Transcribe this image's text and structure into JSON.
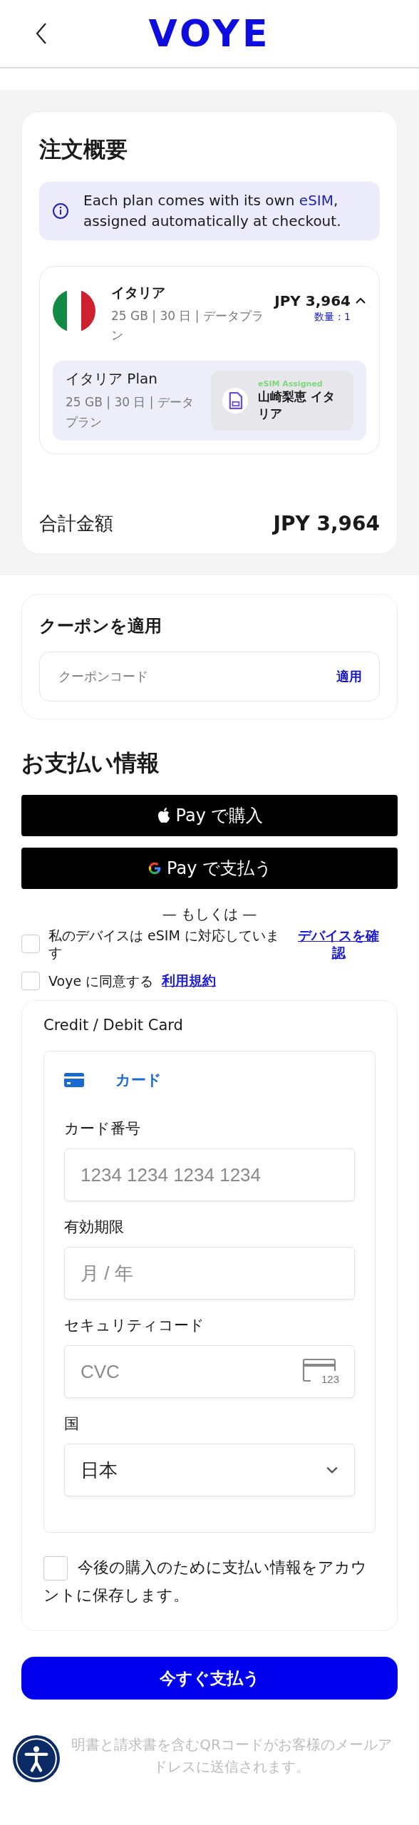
{
  "header": {
    "logo": "VOYE"
  },
  "order_summary": {
    "title": "注文概要",
    "notice": {
      "before": "Each plan comes with its own ",
      "highlight": "eSIM",
      "after": ", assigned automatically at checkout."
    },
    "items": [
      {
        "country": "イタリア",
        "details": "25 GB | 30 日 | データプラン",
        "price": "JPY 3,964",
        "quantity": "数量 : 1",
        "expanded": true,
        "plans": [
          {
            "name": "イタリア Plan",
            "details": "25 GB | 30 日 | データプラン",
            "esim_status": "eSIM Assigned",
            "esim_label": "山崎梨恵 イタリア"
          }
        ]
      }
    ],
    "total_label": "合計金額",
    "total": "JPY 3,964"
  },
  "coupon": {
    "title": "クーポンを適用",
    "placeholder": "クーポンコード",
    "apply": "適用"
  },
  "payment": {
    "title": "お支払い情報",
    "wallet_buttons": [
      {
        "kind": "apple",
        "label": "Pay で購入"
      },
      {
        "kind": "google",
        "label": "Pay で支払う"
      }
    ],
    "separator": "— もしくは —",
    "agreements": [
      {
        "label": "私のデバイスは eSIM に対応しています",
        "link": "デバイスを確認",
        "checked": false
      },
      {
        "label": "Voye に同意する",
        "link": "利用規約",
        "checked": false
      }
    ],
    "card_form": {
      "title": "Credit / Debit Card",
      "method_tab": {
        "label": "カード",
        "selected": true
      },
      "fields": [
        {
          "kind": "text",
          "label": "カード番号",
          "placeholder": "1234 1234 1234 1234"
        },
        {
          "kind": "text",
          "label": "有効期限",
          "placeholder": "月 / 年"
        },
        {
          "kind": "cvc",
          "label": "セキュリティコード",
          "placeholder": "CVC",
          "icon_text": "123"
        },
        {
          "kind": "select",
          "label": "国",
          "value": "日本"
        }
      ],
      "save": {
        "label": "今後の購入のために支払い情報をアカウントに保存します。",
        "checked": false
      }
    },
    "pay_button": "今すぐ支払う",
    "footer_note": "明書と請求書を含むQRコードがお客様のメールアドレスに送信されます。"
  }
}
